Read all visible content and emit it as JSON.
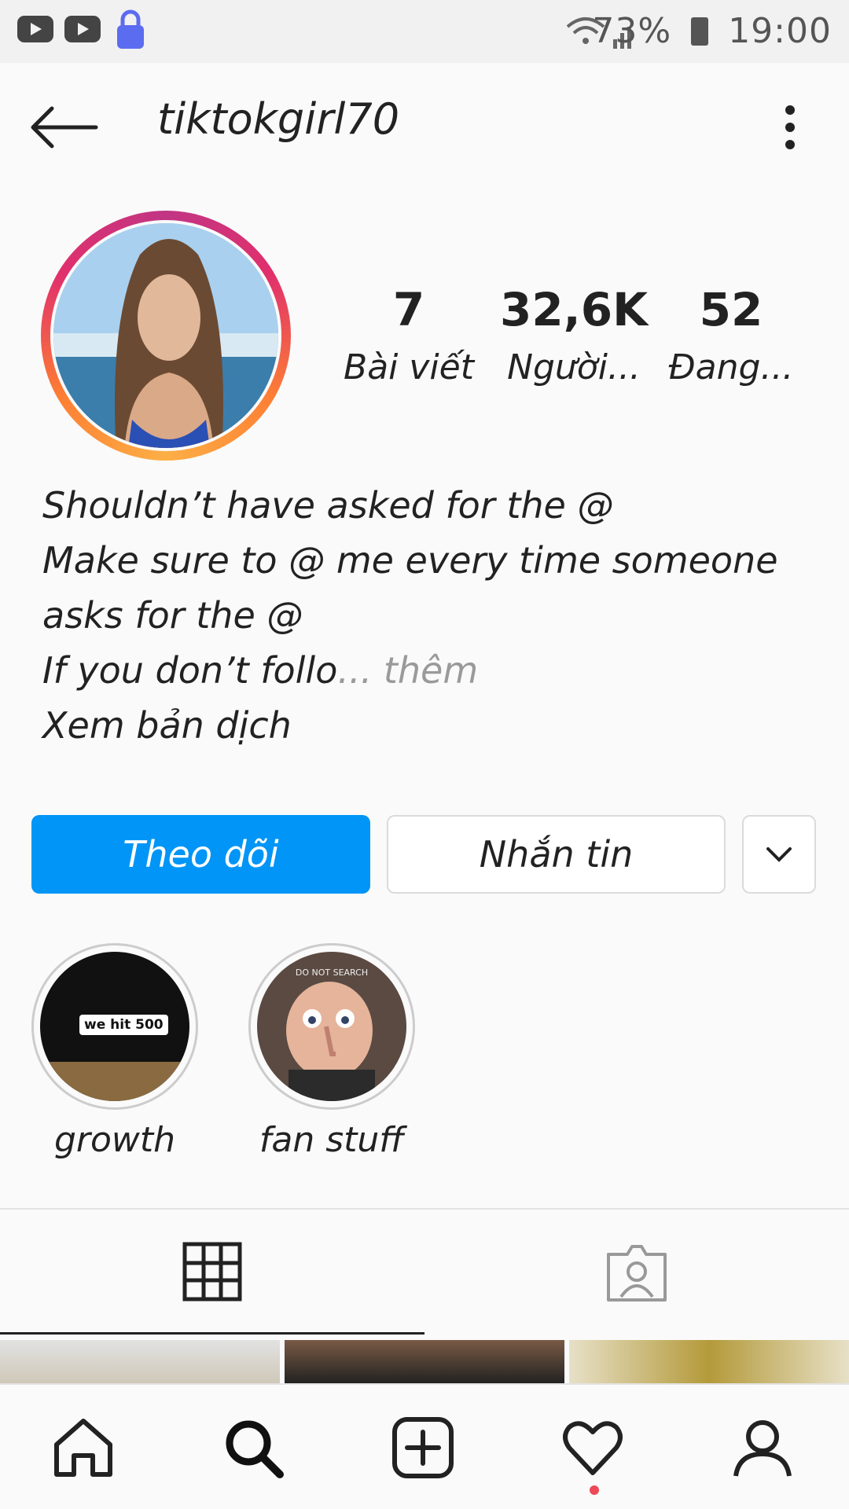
{
  "status": {
    "battery": "73%",
    "time": "19:00"
  },
  "profile": {
    "username": "tiktokgirl70",
    "stats": [
      {
        "value": "7",
        "label": "Bài viết"
      },
      {
        "value": "32,6K",
        "label": "Người..."
      },
      {
        "value": "52",
        "label": "Đang..."
      }
    ]
  },
  "bio": {
    "lines": [
      "Shouldn’t have asked for the @",
      "Make sure to @ me every time someone",
      "asks for the @"
    ],
    "truncated": "If you don’t follo",
    "ellipsis": "...",
    "more": " thêm",
    "translate": "Xem bản dịch"
  },
  "actions": {
    "follow": "Theo dõi",
    "message": "Nhắn tin"
  },
  "highlights": [
    {
      "label": "growth",
      "thumb_text": "we hit 500"
    },
    {
      "label": "fan stuff",
      "thumb_text": "DO NOT SEARCH"
    }
  ],
  "tabs": [
    "grid-icon",
    "tagged-icon"
  ],
  "nav": [
    "home-icon",
    "search-icon",
    "add-post-icon",
    "heart-icon",
    "profile-icon"
  ],
  "colors": {
    "accent": "#0095f6",
    "notification": "#ed4956"
  }
}
